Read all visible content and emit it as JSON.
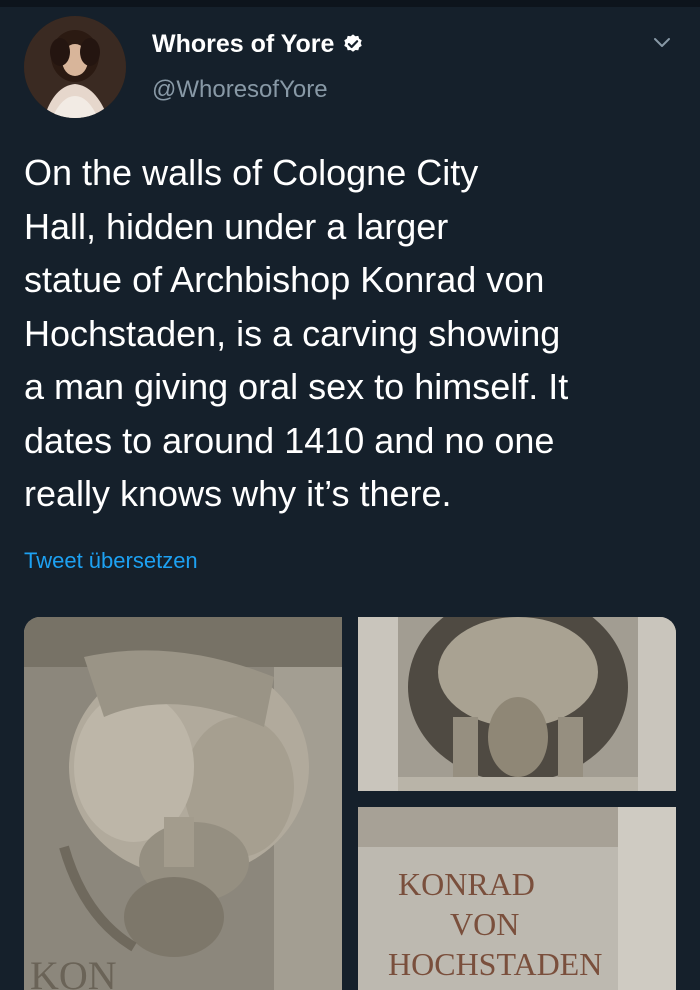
{
  "tweet": {
    "display_name": "Whores of Yore",
    "handle": "@WhoresofYore",
    "text": "On the walls of Cologne City\nHall, hidden under a larger\nstatue of Archbishop Konrad von\nHochstaden,  is a carving showing\na man giving oral sex to himself. It\ndates to around 1410 and no one\nreally knows why it’s there.",
    "translate_label": "Tweet übersetzen",
    "verified": true
  },
  "media": {
    "inscription_lines": [
      "KONRAD",
      "VON",
      "HOCHSTADEN"
    ],
    "left_inscription_fragment": "KON"
  },
  "colors": {
    "background": "#15202b",
    "text": "#ffffff",
    "secondary_text": "#8899a6",
    "link": "#1da1f2"
  },
  "icons": {
    "verified": "verified-badge-icon",
    "more": "chevron-down-icon"
  }
}
